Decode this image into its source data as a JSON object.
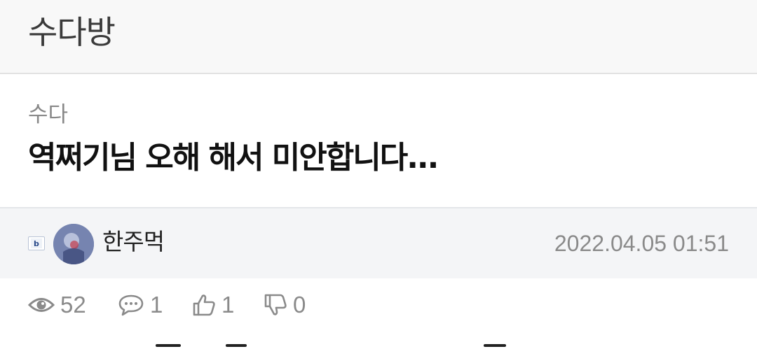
{
  "board": {
    "title": "수다방"
  },
  "post": {
    "category": "수다",
    "title": "역쩌기님 오해 해서 미안합니다...",
    "author": {
      "name": "한주먹",
      "level_badge_icon": "level-badge-icon",
      "avatar_icon": "avatar-image"
    },
    "date": "2022.04.05 01:51",
    "stats": {
      "views": "52",
      "comments": "1",
      "likes": "1",
      "dislikes": "0"
    }
  },
  "colors": {
    "header_bg": "#f8f8f8",
    "meta_bg": "#f4f5f7",
    "muted_text": "#8a8a8a",
    "title_text": "#111111"
  }
}
